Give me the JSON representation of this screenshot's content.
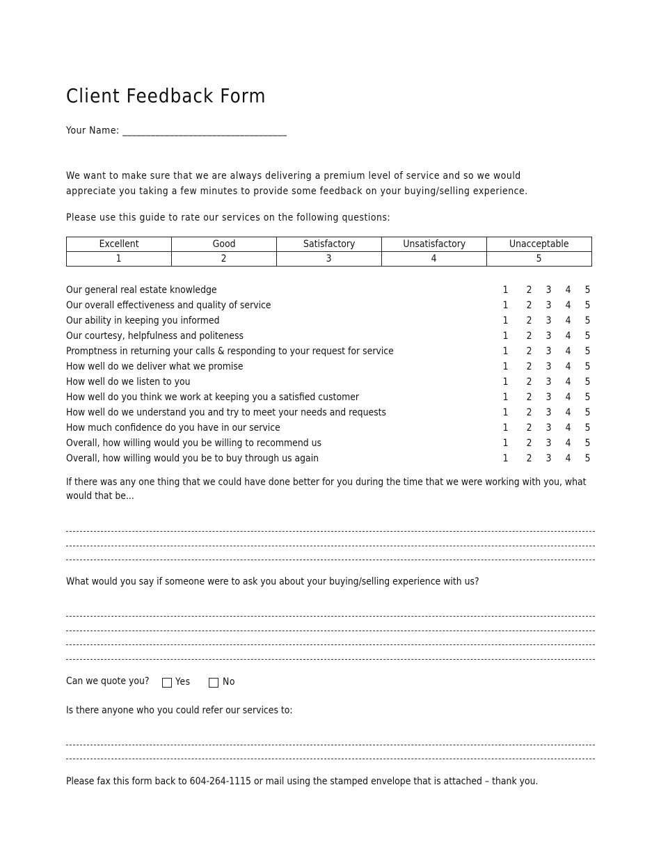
{
  "title": "Client Feedback Form",
  "name_field": {
    "label": "Your Name:",
    "blank": "___________________________________"
  },
  "intro": {
    "line1": "We want to make sure that we are always delivering a premium level of service and so we would",
    "line2": "appreciate you taking a few minutes to provide some feedback on your buying/selling experience."
  },
  "guide_text": "Please use this guide to rate our services on the following questions:",
  "rating_scale": [
    {
      "label": "Excellent",
      "value": "1"
    },
    {
      "label": "Good",
      "value": "2"
    },
    {
      "label": "Satisfactory",
      "value": "3"
    },
    {
      "label": "Unsatisfactory",
      "value": "4"
    },
    {
      "label": "Unacceptable",
      "value": "5"
    }
  ],
  "rating_options": [
    "1",
    "2",
    "3",
    "4",
    "5"
  ],
  "questions": [
    "Our general real estate knowledge",
    "Our overall effectiveness and quality of service",
    "Our ability in keeping you informed",
    "Our courtesy, helpfulness and politeness",
    "Promptness in returning your calls &  responding to your request for service",
    "How well do we deliver what we promise",
    "How well do we listen to you",
    "How well do you think we work at keeping you a satisfied customer",
    "How well do we understand you and try to meet your needs and requests",
    "How much confidence do you have in our service",
    "Overall, how willing would you be willing to recommend us",
    "Overall, how willing would you be to buy through us again"
  ],
  "improvement": {
    "line1": "If there was any one thing that we could have done better for you during the time that we were working with you, what",
    "line2": "would that be..."
  },
  "experience_question": "What would you say if someone were to ask you about your buying/selling experience with us?",
  "quote": {
    "label": "Can we quote you?",
    "yes": "Yes",
    "no": "No",
    "yes_checked": false,
    "no_checked": false
  },
  "referral_question": "Is there anyone who you could refer our services to:",
  "footer": "Please fax this form back to 604-264-1115 or mail using the stamped envelope that is attached – thank you."
}
